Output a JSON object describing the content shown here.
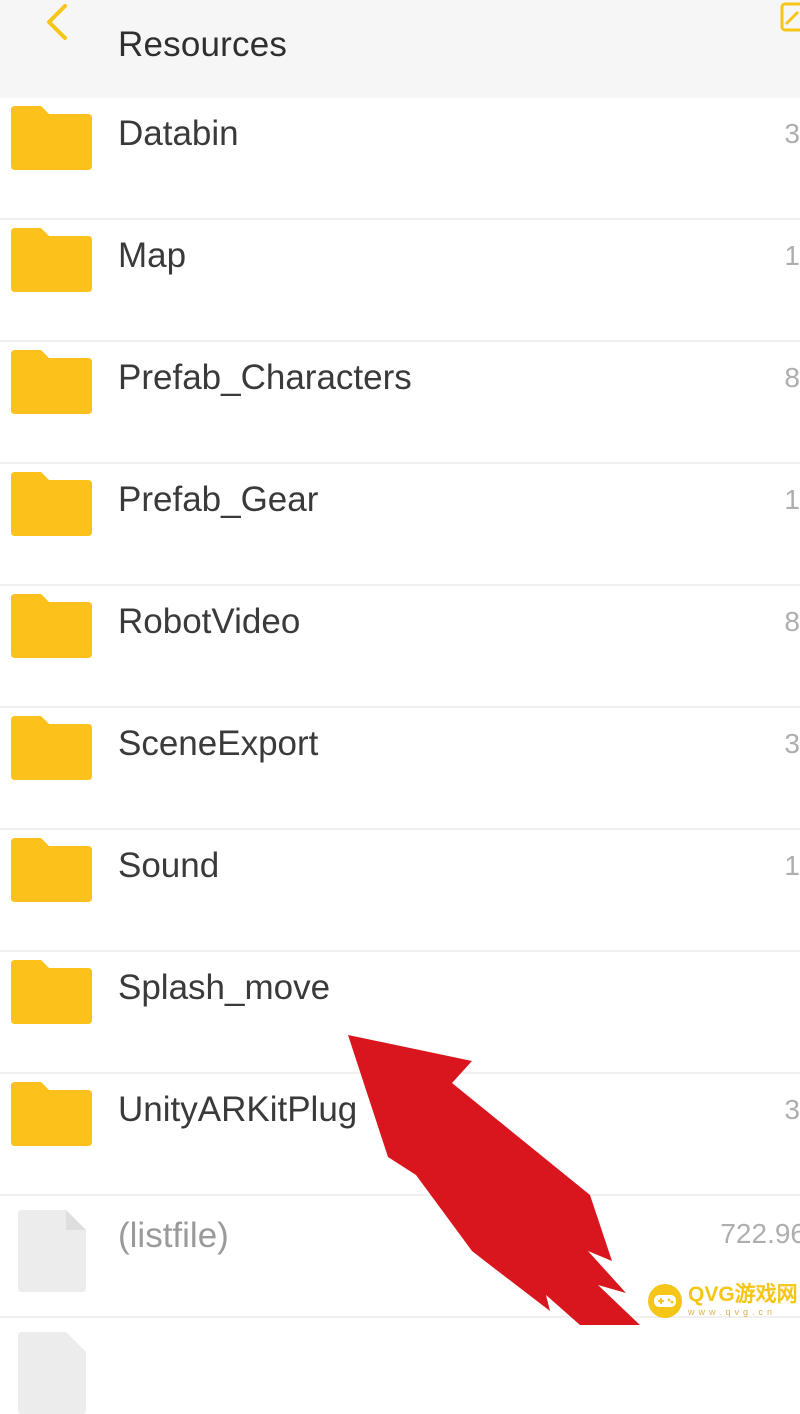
{
  "header": {
    "title": "Resources",
    "back_icon": "chevron-left-icon",
    "corner_icon": "edit-icon"
  },
  "colors": {
    "accent": "#f5c518",
    "folder": "#fcc21b",
    "arrow": "#d9151d"
  },
  "items": [
    {
      "name": "Databin",
      "type": "folder",
      "meta": "3"
    },
    {
      "name": "Map",
      "type": "folder",
      "meta": "1"
    },
    {
      "name": "Prefab_Characters",
      "type": "folder",
      "meta": "8"
    },
    {
      "name": "Prefab_Gear",
      "type": "folder",
      "meta": "1"
    },
    {
      "name": "RobotVideo",
      "type": "folder",
      "meta": "8"
    },
    {
      "name": "SceneExport",
      "type": "folder",
      "meta": "3"
    },
    {
      "name": "Sound",
      "type": "folder",
      "meta": "1"
    },
    {
      "name": "Splash_move",
      "type": "folder",
      "meta": ""
    },
    {
      "name": "UnityARKitPlug",
      "type": "folder",
      "meta": "3"
    },
    {
      "name": "(listfile)",
      "type": "file",
      "meta": "722.96"
    }
  ],
  "watermark": {
    "text": "QVG游戏网",
    "subtext": "www.qvg.cn"
  }
}
